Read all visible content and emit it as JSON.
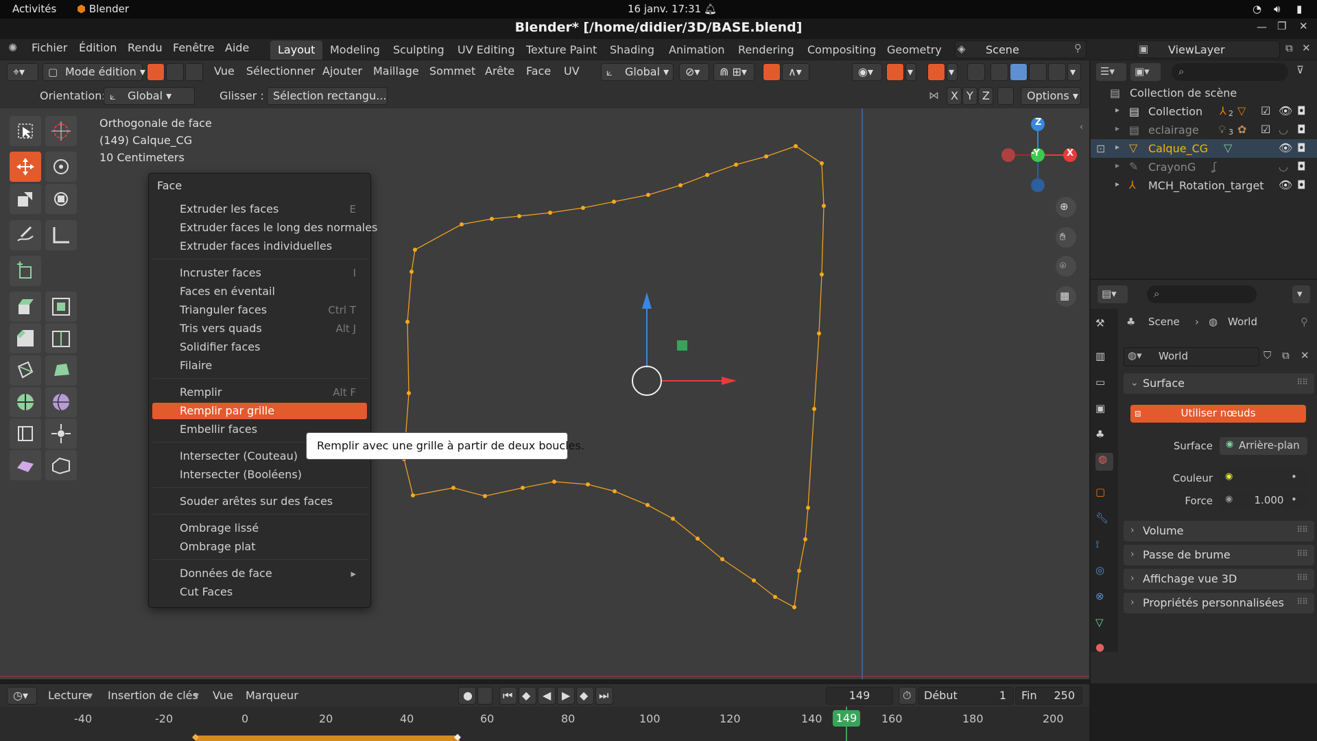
{
  "gnome": {
    "activities": "Activités",
    "app": "Blender",
    "datetime": "16 janv.  17:31"
  },
  "window": {
    "title": "Blender* [/home/didier/3D/BASE.blend]"
  },
  "menubar": {
    "items": [
      "Fichier",
      "Édition",
      "Rendu",
      "Fenêtre",
      "Aide"
    ],
    "workspaces": [
      "Layout",
      "Modeling",
      "Sculpting",
      "UV Editing",
      "Texture Paint",
      "Shading",
      "Animation",
      "Rendering",
      "Compositing",
      "Geometry N"
    ],
    "active_workspace": "Layout",
    "scene": "Scene",
    "view_layer": "ViewLayer"
  },
  "viewport_header": {
    "mode": "Mode édition",
    "menus": [
      "Vue",
      "Sélectionner",
      "Ajouter",
      "Maillage",
      "Sommet",
      "Arête",
      "Face",
      "UV"
    ],
    "transform": "Global"
  },
  "tool_settings": {
    "orientation_label": "Orientation:",
    "orientation_value": "Global",
    "drag_label": "Glisser :",
    "drag_value": "Sélection rectangu...",
    "axes": [
      "X",
      "Y",
      "Z"
    ],
    "options": "Options"
  },
  "viewport_info": {
    "line1": "Orthogonale de face",
    "line2": "(149) Calque_CG",
    "line3": "10 Centimeters"
  },
  "gizmo": {
    "z": "Z",
    "y": "-Y",
    "x": "X"
  },
  "context_menu": {
    "title": "Face",
    "items": [
      {
        "label": "Extruder les faces",
        "shortcut": "E"
      },
      {
        "label": "Extruder faces le long des normales",
        "shortcut": ""
      },
      {
        "label": "Extruder faces individuelles",
        "shortcut": ""
      },
      {
        "label": "Incruster faces",
        "shortcut": "I"
      },
      {
        "label": "Faces en éventail",
        "shortcut": ""
      },
      {
        "label": "Trianguler faces",
        "shortcut": "Ctrl T"
      },
      {
        "label": "Tris vers quads",
        "shortcut": "Alt J"
      },
      {
        "label": "Solidifier faces",
        "shortcut": ""
      },
      {
        "label": "Filaire",
        "shortcut": ""
      },
      {
        "label": "Remplir",
        "shortcut": "Alt F"
      },
      {
        "label": "Remplir par grille",
        "shortcut": ""
      },
      {
        "label": "Embellir faces",
        "shortcut": ""
      },
      {
        "label": "Intersecter (Couteau)",
        "shortcut": ""
      },
      {
        "label": "Intersecter (Booléens)",
        "shortcut": ""
      },
      {
        "label": "Souder arêtes sur des faces",
        "shortcut": ""
      },
      {
        "label": "Ombrage lissé",
        "shortcut": ""
      },
      {
        "label": "Ombrage plat",
        "shortcut": ""
      },
      {
        "label": "Données de face",
        "shortcut": ""
      },
      {
        "label": "Cut Faces",
        "shortcut": ""
      }
    ],
    "highlighted": "Remplir par grille",
    "tooltip": "Remplir avec une grille à partir de deux boucles."
  },
  "outliner": {
    "root": "Collection de scène",
    "rows": [
      {
        "name": "Collection",
        "badge": "2"
      },
      {
        "name": "eclairage",
        "badge": "3"
      },
      {
        "name": "Calque_CG",
        "badge": ""
      },
      {
        "name": "CrayonG",
        "badge": ""
      },
      {
        "name": "MCH_Rotation_target",
        "badge": ""
      }
    ],
    "active": "Calque_CG"
  },
  "properties": {
    "breadcrumb_scene": "Scene",
    "breadcrumb_world": "World",
    "world_name": "World",
    "surface_panel": "Surface",
    "use_nodes": "Utiliser nœuds",
    "surface_label": "Surface",
    "surface_value": "Arrière-plan",
    "color_label": "Couleur",
    "strength_label": "Force",
    "strength_value": "1.000",
    "collapsed_panels": [
      "Volume",
      "Passe de brume",
      "Affichage vue 3D",
      "Propriétés personnalisées"
    ]
  },
  "timeline": {
    "playback": "Lecture",
    "keying": "Insertion de clés",
    "view": "Vue",
    "marker": "Marqueur",
    "current_frame": "149",
    "start_label": "Début",
    "start": "1",
    "end_label": "Fin",
    "end": "250",
    "ticks": [
      "-40",
      "-20",
      "0",
      "20",
      "40",
      "60",
      "80",
      "100",
      "120",
      "140",
      "160",
      "180",
      "200"
    ],
    "playhead": "149"
  },
  "colors": {
    "accent": "#e35a2d",
    "active_object": "#f5b800",
    "gizmo_x": "#e83b3b",
    "gizmo_y": "#3cc94f",
    "gizmo_z": "#3b86e0"
  }
}
